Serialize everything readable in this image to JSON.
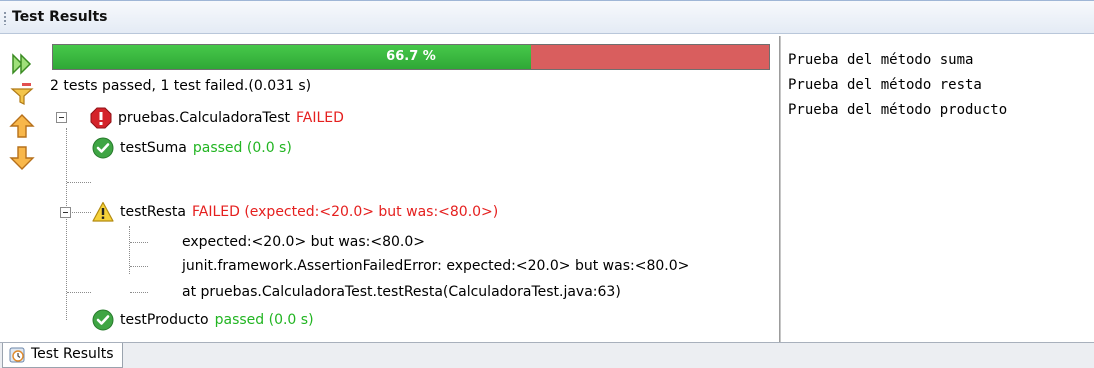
{
  "window": {
    "title": "Test Results"
  },
  "toolbar": {
    "icons": [
      "rerun-icon",
      "filter-icon",
      "previous-failure-icon",
      "next-failure-icon"
    ]
  },
  "progress": {
    "percent": 66.7,
    "label": "66.7 %",
    "pass_color": "#3cb83f",
    "fail_color": "#d95e5e"
  },
  "summary": {
    "text": "2 tests passed, 1 test failed.(0.031 s)"
  },
  "tree": {
    "suite": {
      "name": "pruebas.CalculadoraTest",
      "status": "FAILED"
    },
    "tests": [
      {
        "name": "testSuma",
        "status": "passed  (0.0 s)"
      },
      {
        "name": "testResta",
        "status": "FAILED  (expected:<20.0> but was:<80.0>)",
        "details": [
          "expected:<20.0> but was:<80.0>",
          "junit.framework.AssertionFailedError: expected:<20.0> but was:<80.0>",
          "at pruebas.CalculadoraTest.testResta(CalculadoraTest.java:63)"
        ]
      },
      {
        "name": "testProducto",
        "status": "passed  (0.0 s)"
      }
    ]
  },
  "output": {
    "lines": [
      "Prueba del método suma",
      "Prueba del método resta",
      "Prueba del método producto"
    ]
  },
  "bottom_tab": {
    "label": "Test Results"
  }
}
